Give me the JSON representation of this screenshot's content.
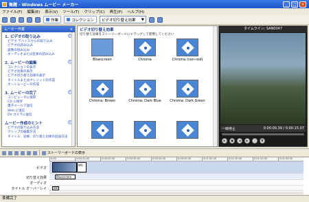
{
  "window": {
    "title": "無題 - Windows ムービー メーカー"
  },
  "menu": [
    "ファイル(F)",
    "編集(E)",
    "表示(V)",
    "ツール(T)",
    "クリップ(C)",
    "再生(P)",
    "ヘルプ(H)"
  ],
  "toolbar": {
    "tasks_label": "作業",
    "collections_label": "コレクション",
    "collection_dropdown": "ビデオ切り替え効果"
  },
  "taskpane": {
    "header": "ムービー作業",
    "sections": [
      {
        "title": "1. ビデオの取り込み",
        "links": [
          "ビデオ デバイスからの取り込み",
          "ビデオの読み込み",
          "画像の読み込み",
          "オーディオまたは音楽の読み込み"
        ]
      },
      {
        "title": "2. ムービーの編集",
        "links": [
          "コレクションの表示",
          "ビデオ効果の表示",
          "ビデオ切り替え効果の表示",
          "タイトルまたはクレジットの作成",
          "オートムービーの作成"
        ]
      },
      {
        "title": "3. ムービーの完了",
        "links": [
          "コンピュータに保存",
          "CD に保存",
          "電子メールで送信",
          "Web に送信",
          "DV カメラに送信"
        ]
      },
      {
        "title": "ムービー作成のヒント",
        "links": [
          "ビデオの取り込み方法",
          "クリップの編集方法",
          "タイトル、効果、切り替え効果の追加方法"
        ]
      }
    ]
  },
  "effects": {
    "heading": "ビデオ切り替え効果",
    "subheading": "切り替え効果をストーリーボードにドラッグして使用してください",
    "items": [
      "Bluescreen",
      "Chroma",
      "Chroma (non-red)",
      "Chroma: Brown",
      "Chroma: Dark Blue",
      "Chroma: Dark Green",
      "",
      "",
      ""
    ]
  },
  "monitor": {
    "title": "タイムライン: SAN0047",
    "status": "一時停止",
    "time": "0:00:00.39 / 0:00:15.07"
  },
  "timeline_toolbar": {
    "toggle_label": "ストーリーボードの表示"
  },
  "timeline": {
    "ruler": [
      "0:00",
      "0:00:10.00",
      "0:00:20.00",
      "0:00:30.00",
      "0:00:40.00",
      "0:00:50.00",
      "0:01:00.00",
      "0:01:10.00",
      "0:01:20.00",
      "0:01:30.00"
    ],
    "tracks": {
      "video": "ビデオ",
      "transition": "切り替え効果",
      "audio": "オーディオ",
      "overlay": "タイトル オーバーレイ"
    },
    "clips": {
      "video2": "WV...",
      "transition": "Bluescreen",
      "overlay": "Ber"
    }
  },
  "statusbar": "準備完了"
}
